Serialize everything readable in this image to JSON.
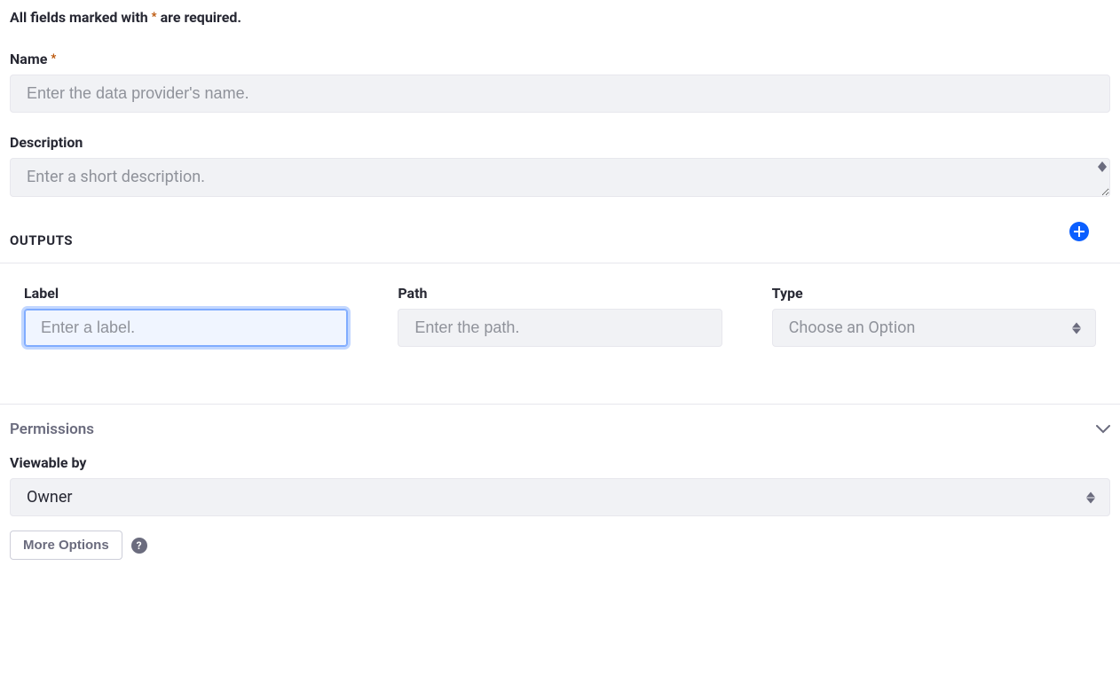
{
  "notice": {
    "prefix": "All fields marked with",
    "suffix": "are required."
  },
  "name": {
    "label": "Name",
    "placeholder": "Enter the data provider's name."
  },
  "description": {
    "label": "Description",
    "placeholder": "Enter a short description."
  },
  "outputs": {
    "title": "OUTPUTS",
    "label_col": "Label",
    "label_placeholder": "Enter a label.",
    "path_col": "Path",
    "path_placeholder": "Enter the path.",
    "type_col": "Type",
    "type_placeholder": "Choose an Option"
  },
  "permissions": {
    "title": "Permissions",
    "viewable_label": "Viewable by",
    "viewable_value": "Owner",
    "more_options": "More Options"
  }
}
